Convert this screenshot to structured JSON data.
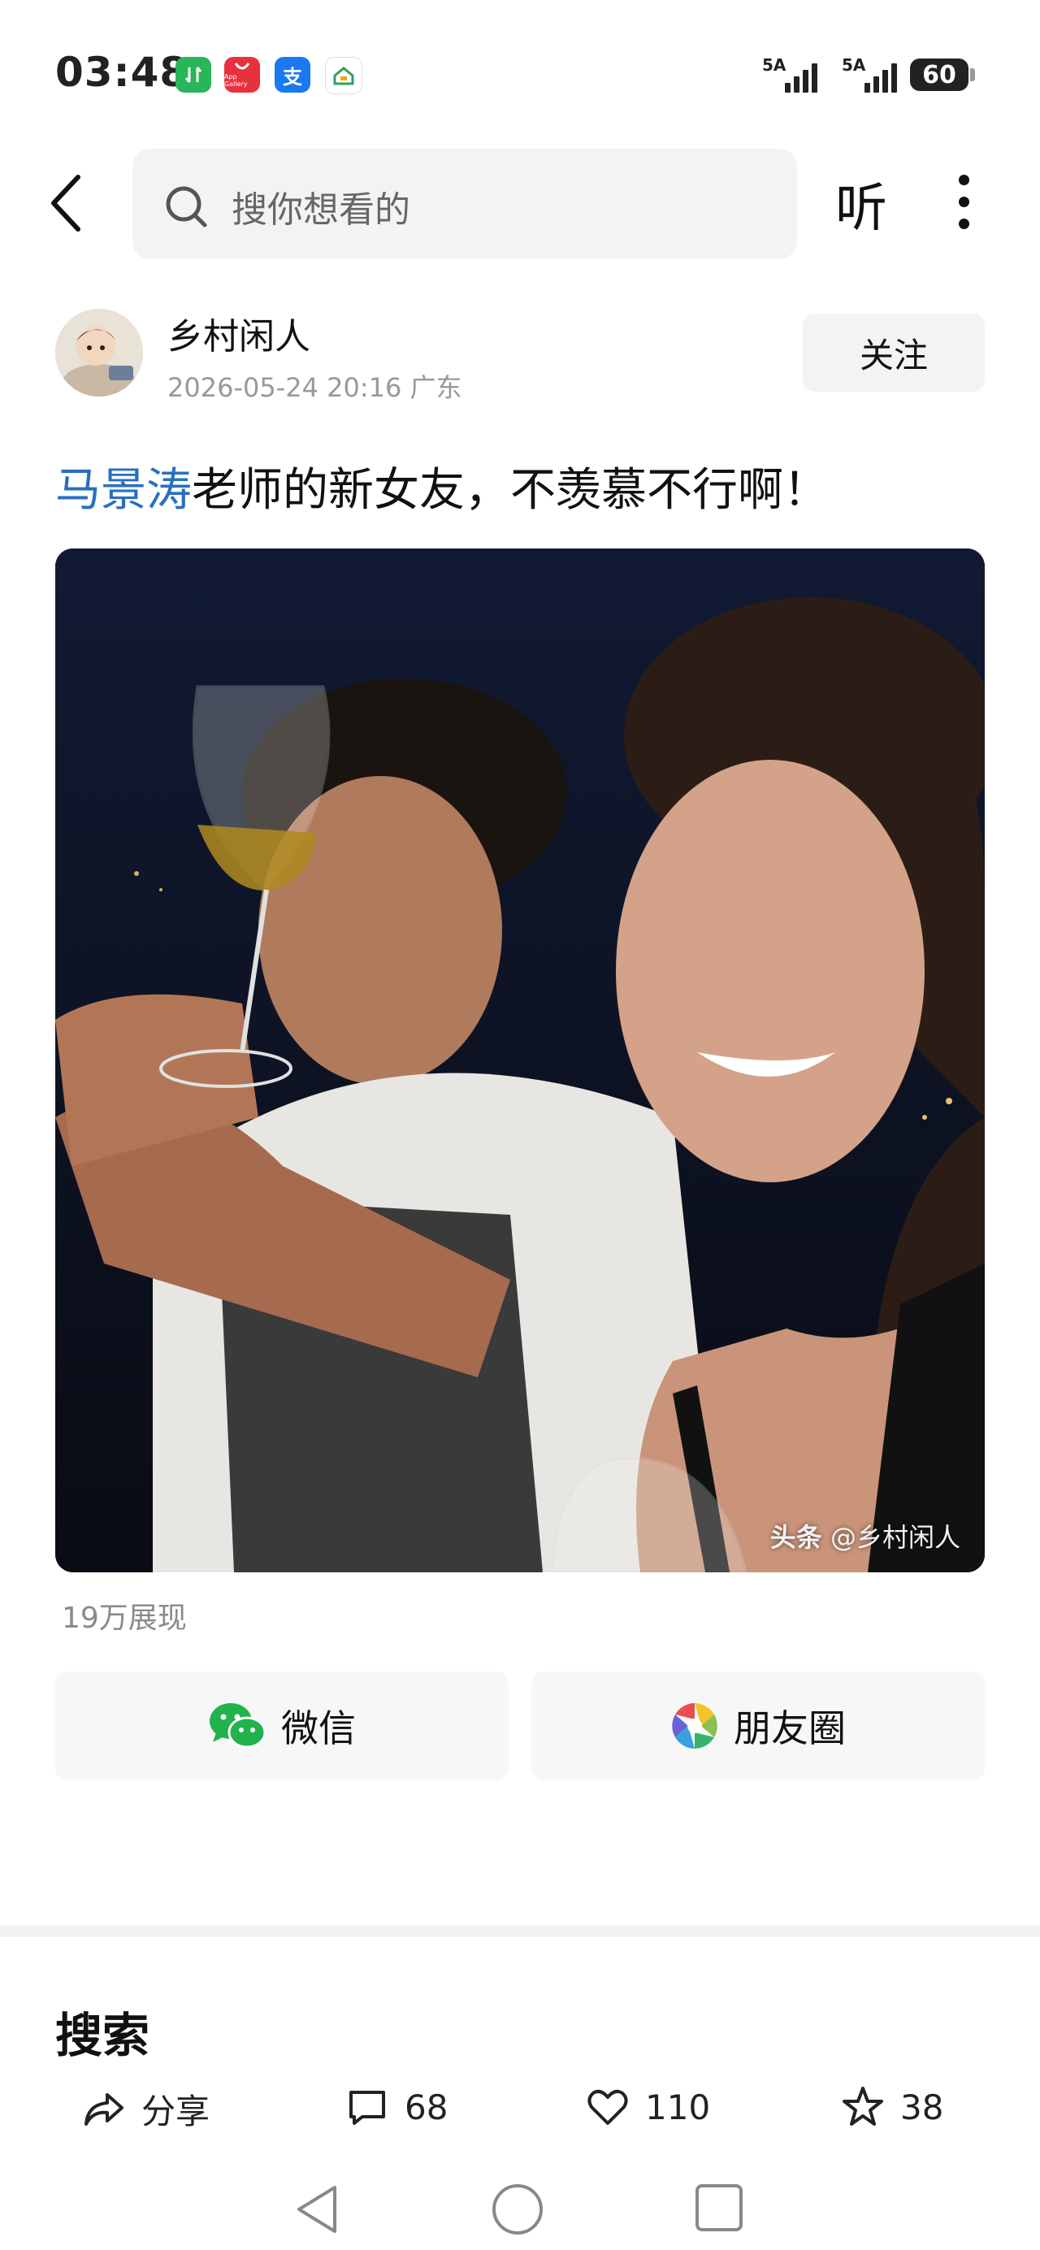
{
  "status_bar": {
    "time": "03:48",
    "app_icons": [
      "transfer-app-icon",
      "app-gallery-icon",
      "alipay-icon",
      "home-app-icon"
    ],
    "app_gallery_text": "App Gallery",
    "alipay_text": "支",
    "signal_1_label": "5A",
    "signal_2_label": "5A",
    "battery": "60"
  },
  "top_bar": {
    "search_placeholder": "搜你想看的",
    "listen_label": "听"
  },
  "author": {
    "name": "乡村闲人",
    "meta": "2026-05-24 20:16 广东",
    "follow_label": "关注"
  },
  "post": {
    "title_keyword": "马景涛",
    "title_rest": "老师的新女友，不羡慕不行啊！",
    "watermark_brand": "头条",
    "watermark_user": "@乡村闲人",
    "impressions": "19万展现"
  },
  "share": {
    "wechat_label": "微信",
    "moments_label": "朋友圈"
  },
  "section": {
    "search_title": "搜索"
  },
  "action_bar": {
    "share_label": "分享",
    "comments": "68",
    "likes": "110",
    "favorites": "38"
  },
  "colors": {
    "keyword_blue": "#2a6fbf",
    "wechat_green": "#22b24c"
  }
}
